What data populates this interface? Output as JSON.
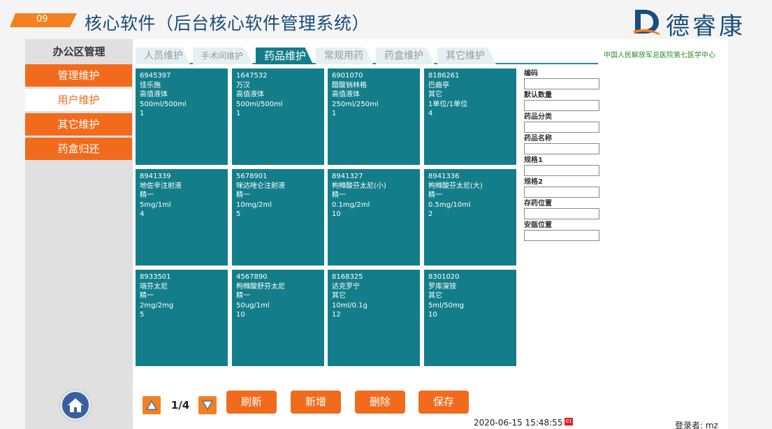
{
  "header": {
    "slide_number": "09",
    "title": "核心软件（后台核心软件管理系统）",
    "logo_text": "德睿康",
    "accent_color": "#f5801f",
    "title_color": "#1a4d7a"
  },
  "sidebar": {
    "title": "办公区管理",
    "items": [
      {
        "label": "管理维护",
        "active": false
      },
      {
        "label": "用户维护",
        "active": true
      },
      {
        "label": "其它维护",
        "active": false
      },
      {
        "label": "药盒归还",
        "active": false
      }
    ],
    "home_icon": "home-icon"
  },
  "tabs": [
    {
      "label": "人员维护",
      "active": false
    },
    {
      "label": "手术间维护",
      "active": false
    },
    {
      "label": "药品维护",
      "active": true
    },
    {
      "label": "常规用药",
      "active": false
    },
    {
      "label": "药盒维护",
      "active": false
    },
    {
      "label": "其它维护",
      "active": false
    }
  ],
  "org_name": "中国人民解放军总医院第七医学中心",
  "drugs": [
    {
      "code": "6945397",
      "name": "佳乐施",
      "category": "高值液体",
      "spec": "500ml/500ml",
      "qty": "1"
    },
    {
      "code": "1647532",
      "name": "万汉",
      "category": "高值液体",
      "spec": "500ml/500ml",
      "qty": "1"
    },
    {
      "code": "6901070",
      "name": "醋酸钠林格",
      "category": "高值液体",
      "spec": "250ml/250ml",
      "qty": "1"
    },
    {
      "code": "8186261",
      "name": "巴曲亭",
      "category": "其它",
      "spec": "1单位/1单位",
      "qty": "4"
    },
    {
      "code": "8941339",
      "name": "地佐辛注射液",
      "category": "精一",
      "spec": "5mg/1ml",
      "qty": "4"
    },
    {
      "code": "5678901",
      "name": "咪达唑仑注射液",
      "category": "精一",
      "spec": "10mg/2ml",
      "qty": "5"
    },
    {
      "code": "8941327",
      "name": "枸橼酸芬太尼(小)",
      "category": "精一",
      "spec": "0.1mg/2ml",
      "qty": "10"
    },
    {
      "code": "8941336",
      "name": "枸橼酸芬太尼(大)",
      "category": "精一",
      "spec": "0.5mg/10ml",
      "qty": "2"
    },
    {
      "code": "8933501",
      "name": "瑞芬太尼",
      "category": "精一",
      "spec": "2mg/2mg",
      "qty": "5"
    },
    {
      "code": "4567890",
      "name": "枸橼酸舒芬太尼",
      "category": "精一",
      "spec": "50ug/1ml",
      "qty": "10"
    },
    {
      "code": "8168325",
      "name": "达克罗宁",
      "category": "其它",
      "spec": "10ml/0.1g",
      "qty": "12"
    },
    {
      "code": "8301020",
      "name": "罗库溴铵",
      "category": "其它",
      "spec": "5ml/50mg",
      "qty": "10"
    }
  ],
  "form": {
    "fields": [
      {
        "label": "编码",
        "value": ""
      },
      {
        "label": "默认数量",
        "value": ""
      },
      {
        "label": "药品分类",
        "value": ""
      },
      {
        "label": "药品名称",
        "value": ""
      },
      {
        "label": "规格1",
        "value": ""
      },
      {
        "label": "规格2",
        "value": ""
      },
      {
        "label": "存药位置",
        "value": ""
      },
      {
        "label": "安瓿位置",
        "value": ""
      }
    ]
  },
  "pager": {
    "text": "1/4",
    "up_icon": "triangle-up-icon",
    "down_icon": "triangle-down-icon"
  },
  "buttons": {
    "refresh": "刷新",
    "add": "新增",
    "delete": "删除",
    "save": "保存"
  },
  "footer": {
    "datetime": "2020-06-15 15:48:55",
    "badge": "01",
    "login": "登录者: mz"
  }
}
